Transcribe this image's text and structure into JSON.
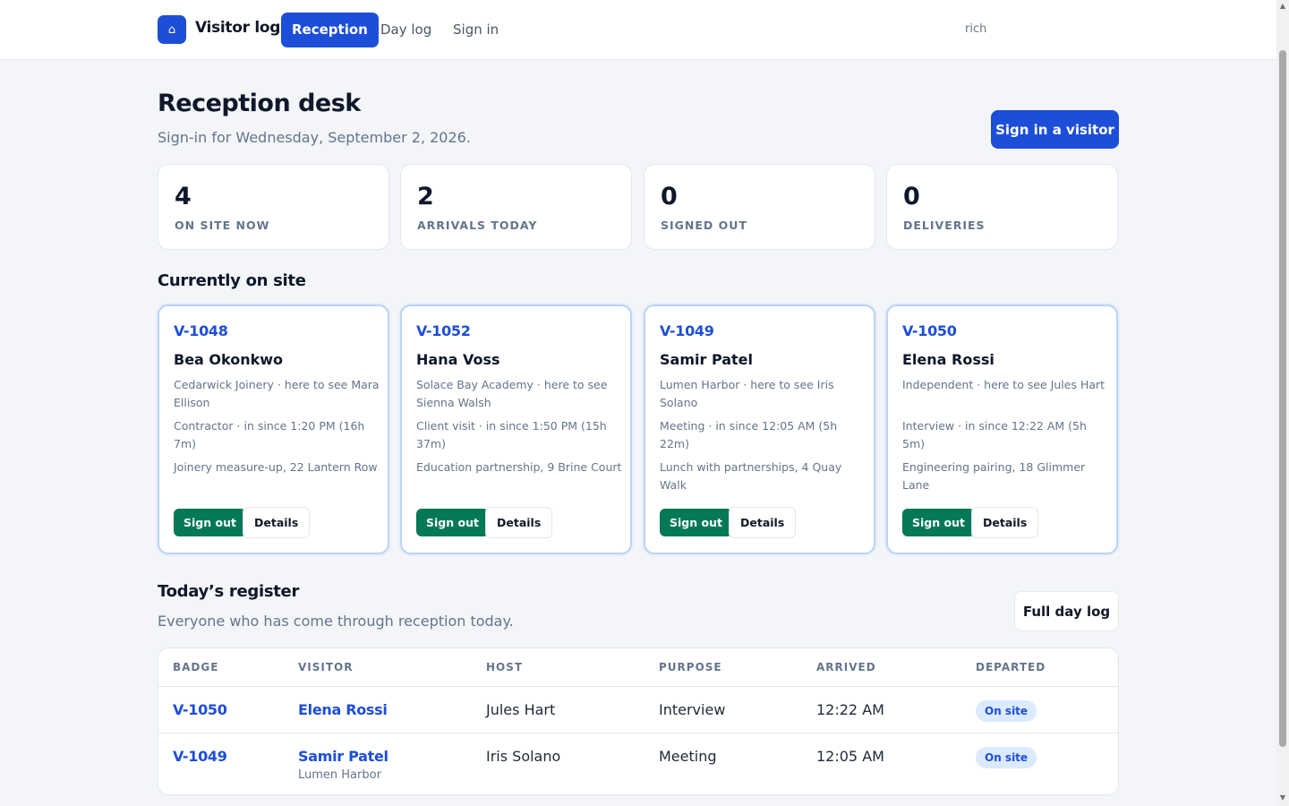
{
  "app": {
    "icon": "home-icon",
    "name": "Visitor log",
    "user": "rich"
  },
  "nav": [
    {
      "label": "Reception",
      "active": true
    },
    {
      "label": "Day log",
      "active": false
    },
    {
      "label": "Sign in",
      "active": false
    }
  ],
  "header": {
    "title": "Reception desk",
    "subtitle": "Sign-in for Wednesday, September 2, 2026.",
    "primary_action": "Sign in a visitor"
  },
  "stats": [
    {
      "value": "4",
      "label": "ON SITE NOW"
    },
    {
      "value": "2",
      "label": "ARRIVALS TODAY"
    },
    {
      "value": "0",
      "label": "SIGNED OUT"
    },
    {
      "value": "0",
      "label": "DELIVERIES"
    }
  ],
  "on_site": {
    "title": "Currently on site",
    "signout_label": "Sign out",
    "details_label": "Details",
    "visitors": [
      {
        "badge": "V-1048",
        "name": "Bea Okonkwo",
        "org_host": "Cedarwick Joinery · here to see Mara Ellison",
        "type_time": "Contractor · in since 1:20 PM (16h 7m)",
        "note": "Joinery measure-up, 22 Lantern Row"
      },
      {
        "badge": "V-1052",
        "name": "Hana Voss",
        "org_host": "Solace Bay Academy · here to see Sienna Walsh",
        "type_time": "Client visit · in since 1:50 PM (15h 37m)",
        "note": "Education partnership, 9 Brine Court"
      },
      {
        "badge": "V-1049",
        "name": "Samir Patel",
        "org_host": "Lumen Harbor · here to see Iris Solano",
        "type_time": "Meeting · in since 12:05 AM (5h 22m)",
        "note": "Lunch with partnerships, 4 Quay Walk"
      },
      {
        "badge": "V-1050",
        "name": "Elena Rossi",
        "org_host": "Independent · here to see Jules Hart",
        "type_time": "Interview · in since 12:22 AM (5h 5m)",
        "note": "Engineering pairing, 18 Glimmer Lane"
      }
    ]
  },
  "register": {
    "title": "Today’s register",
    "subtitle": "Everyone who has come through reception today.",
    "full_log_label": "Full day log",
    "columns": [
      "BADGE",
      "VISITOR",
      "HOST",
      "PURPOSE",
      "ARRIVED",
      "DEPARTED"
    ],
    "rows": [
      {
        "badge": "V-1050",
        "visitor": "Elena Rossi",
        "org": "",
        "host": "Jules Hart",
        "purpose": "Interview",
        "arrived": "12:22 AM",
        "departed": "On site"
      },
      {
        "badge": "V-1049",
        "visitor": "Samir Patel",
        "org": "Lumen Harbor",
        "host": "Iris Solano",
        "purpose": "Meeting",
        "arrived": "12:05 AM",
        "departed": "On site"
      }
    ]
  },
  "colors": {
    "accent": "#1d4ed8",
    "success": "#047857",
    "muted": "#64748b"
  }
}
